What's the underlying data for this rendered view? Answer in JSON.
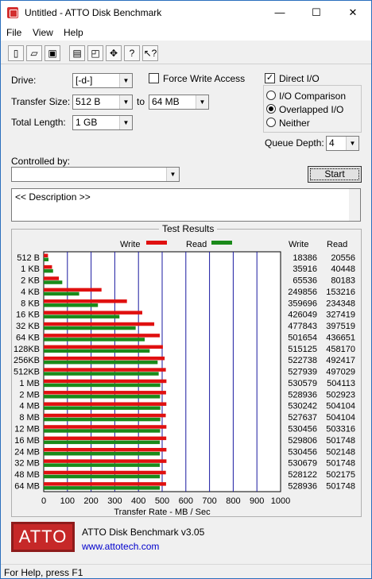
{
  "window": {
    "title": "Untitled - ATTO Disk Benchmark",
    "minimize": "—",
    "maximize": "☐",
    "close": "✕"
  },
  "menu": [
    "File",
    "View",
    "Help"
  ],
  "toolbar": {
    "icons": [
      "new-icon",
      "open-icon",
      "save-icon",
      "print-icon",
      "print-preview-icon",
      "move-icon",
      "help-icon",
      "context-help-icon"
    ]
  },
  "settings": {
    "drive_label": "Drive:",
    "drive_value": "[-d-]",
    "transfer_label": "Transfer Size:",
    "transfer_from": "512 B",
    "to_label": "to",
    "transfer_to": "64 MB",
    "length_label": "Total Length:",
    "length_value": "1 GB",
    "force_write_label": "Force Write Access",
    "force_write_checked": false,
    "direct_io_label": "Direct I/O",
    "direct_io_checked": true,
    "io_comparison_label": "I/O Comparison",
    "overlapped_io_label": "Overlapped I/O",
    "neither_label": "Neither",
    "io_mode_selected": "Overlapped I/O",
    "queue_label": "Queue Depth:",
    "queue_value": "4",
    "controlled_label": "Controlled by:",
    "controlled_value": "",
    "start_label": "Start",
    "description": "<< Description >>"
  },
  "results": {
    "title": "Test Results",
    "legend_write": "Write",
    "legend_read": "Read",
    "col_write": "Write",
    "col_read": "Read",
    "write_color": "#e01010",
    "read_color": "#1a8a1a"
  },
  "chart_data": {
    "type": "bar",
    "orientation": "horizontal",
    "xlabel": "Transfer Rate - MB / Sec",
    "xlim": [
      0,
      1000
    ],
    "xticks": [
      "0",
      "100",
      "200",
      "300",
      "400",
      "500",
      "600",
      "700",
      "800",
      "900",
      "1000"
    ],
    "categories": [
      "512 B",
      "1 KB",
      "2 KB",
      "4 KB",
      "8 KB",
      "16 KB",
      "32 KB",
      "64 KB",
      "128KB",
      "256KB",
      "512KB",
      "1 MB",
      "2 MB",
      "4 MB",
      "8 MB",
      "12 MB",
      "16 MB",
      "24 MB",
      "32 MB",
      "48 MB",
      "64 MB"
    ],
    "series": [
      {
        "name": "Write",
        "color": "#e01010",
        "values": [
          18386,
          35916,
          65536,
          249856,
          359696,
          426049,
          477843,
          501654,
          515125,
          522738,
          527939,
          530579,
          528936,
          530242,
          527637,
          530456,
          529806,
          530456,
          530679,
          528122,
          528936
        ],
        "mb_values": [
          18.0,
          35.1,
          64.0,
          244.0,
          351.3,
          416.1,
          466.6,
          489.9,
          503.1,
          510.5,
          515.6,
          518.1,
          516.5,
          517.8,
          515.3,
          518.0,
          517.4,
          518.0,
          518.2,
          515.7,
          516.5
        ]
      },
      {
        "name": "Read",
        "color": "#1a8a1a",
        "values": [
          20556,
          40448,
          80183,
          153216,
          234348,
          327419,
          397519,
          436651,
          458170,
          492417,
          497029,
          504113,
          502923,
          504104,
          504104,
          503316,
          501748,
          502148,
          501748,
          502175,
          501748
        ],
        "mb_values": [
          20.1,
          39.5,
          78.3,
          149.6,
          228.9,
          319.7,
          388.2,
          426.4,
          447.4,
          480.9,
          485.4,
          492.3,
          491.1,
          492.3,
          492.3,
          491.5,
          490.0,
          490.4,
          490.0,
          490.4,
          490.0
        ]
      }
    ]
  },
  "footer": {
    "logo": "ATTO",
    "product": "ATTO Disk Benchmark v3.05",
    "link": "www.attotech.com",
    "status": "For Help, press F1"
  }
}
